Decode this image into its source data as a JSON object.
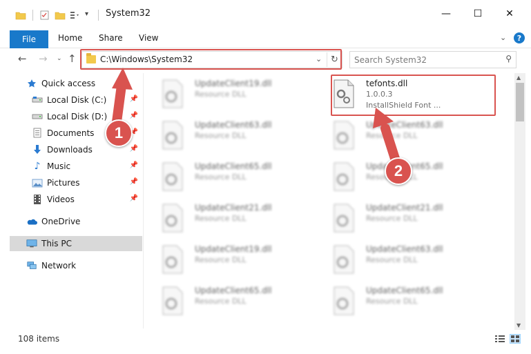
{
  "window": {
    "title": "System32",
    "minimize": "—",
    "maximize": "☐",
    "close": "✕"
  },
  "ribbon": {
    "file": "File",
    "home": "Home",
    "share": "Share",
    "view": "View",
    "expand": "⌄",
    "help": "?"
  },
  "address": {
    "path": "C:\\Windows\\System32",
    "search_placeholder": "Search System32"
  },
  "sidebar": {
    "items": [
      {
        "label": "Quick access",
        "icon": "star-icon",
        "pinned": false
      },
      {
        "label": "Local Disk (C:)",
        "icon": "drive-icon",
        "pinned": true
      },
      {
        "label": "Local Disk (D:)",
        "icon": "drive-icon",
        "pinned": true
      },
      {
        "label": "Documents",
        "icon": "documents-icon",
        "pinned": true
      },
      {
        "label": "Downloads",
        "icon": "download-icon",
        "pinned": true
      },
      {
        "label": "Music",
        "icon": "music-icon",
        "pinned": true
      },
      {
        "label": "Pictures",
        "icon": "pictures-icon",
        "pinned": true
      },
      {
        "label": "Videos",
        "icon": "videos-icon",
        "pinned": true
      },
      {
        "label": "OneDrive",
        "icon": "cloud-icon",
        "pinned": false
      },
      {
        "label": "This PC",
        "icon": "monitor-icon",
        "pinned": false
      },
      {
        "label": "Network",
        "icon": "network-icon",
        "pinned": false
      }
    ]
  },
  "files": {
    "highlighted": {
      "name": "tefonts.dll",
      "version": "1.0.0.3",
      "description": "InstallShield Font ..."
    },
    "left": [
      {
        "name": "UpdateClient19.dll",
        "type": "Resource DLL"
      },
      {
        "name": "UpdateClient63.dll",
        "type": "Resource DLL"
      },
      {
        "name": "UpdateClient65.dll",
        "type": "Resource DLL"
      },
      {
        "name": "UpdateClient21.dll",
        "type": "Resource DLL"
      },
      {
        "name": "UpdateClient19.dll",
        "type": "Resource DLL"
      },
      {
        "name": "UpdateClient65.dll",
        "type": "Resource DLL"
      }
    ],
    "right": [
      {
        "name": "UpdateClient63.dll",
        "type": "Resource DLL"
      },
      {
        "name": "UpdateClient65.dll",
        "type": "Resource DLL"
      },
      {
        "name": "UpdateClient21.dll",
        "type": "Resource DLL"
      },
      {
        "name": "UpdateClient63.dll",
        "type": "Resource DLL"
      },
      {
        "name": "UpdateClient65.dll",
        "type": "Resource DLL"
      }
    ]
  },
  "status": {
    "items": "108 items"
  },
  "annotations": {
    "step1": "1",
    "step2": "2"
  },
  "colors": {
    "accent": "#1979ca",
    "highlight": "#d9534f",
    "selected": "#d9d9d9"
  }
}
